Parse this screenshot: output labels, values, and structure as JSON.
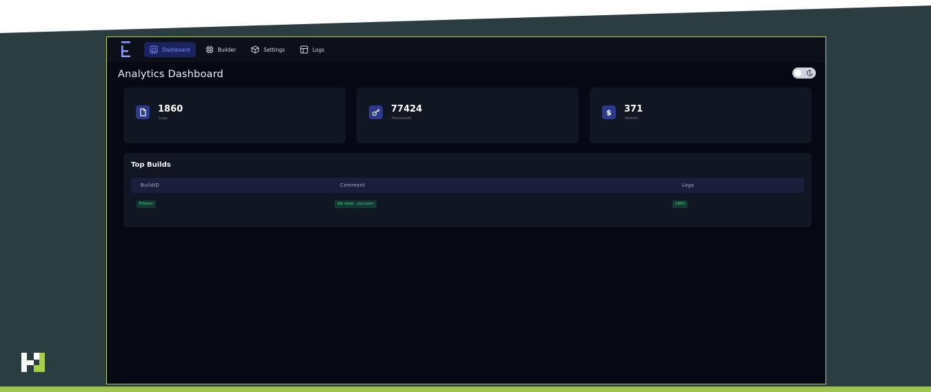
{
  "nav": {
    "logo_glyph": "E",
    "items": [
      {
        "label": "Dashboard",
        "icon": "home-icon",
        "active": true
      },
      {
        "label": "Builder",
        "icon": "cpu-icon",
        "active": false
      },
      {
        "label": "Settings",
        "icon": "box-icon",
        "active": false
      },
      {
        "label": "Logs",
        "icon": "layout-icon",
        "active": false
      }
    ]
  },
  "page": {
    "title": "Analytics Dashboard",
    "theme_toggle_icon": "moon-icon"
  },
  "stats": [
    {
      "value": "1860",
      "label": "Logs",
      "icon": "file-icon"
    },
    {
      "value": "77424",
      "label": "Passwords",
      "icon": "key-icon"
    },
    {
      "value": "371",
      "label": "Wallets",
      "icon": "dollar-icon",
      "glyph": "$"
    }
  ],
  "top_builds": {
    "title": "Top Builds",
    "columns": [
      "BuildID",
      "Comment",
      "Logs"
    ],
    "rows": [
      {
        "build_id": "Erbium",
        "comment": "We steal - you earn",
        "logs": "1860"
      }
    ]
  },
  "colors": {
    "accent": "#7c8dff",
    "frame_border": "#b4d34e",
    "tag_bg": "#123a32",
    "tag_text": "#3fcf8e"
  }
}
